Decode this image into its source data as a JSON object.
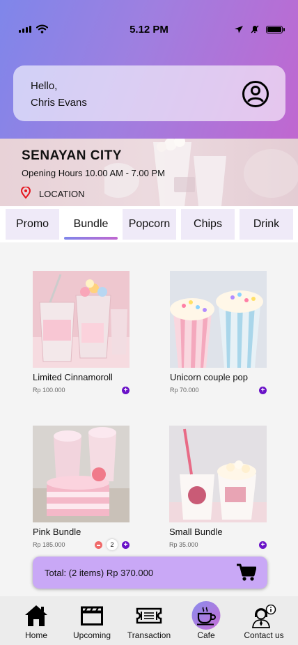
{
  "status_bar": {
    "time": "5.12 PM"
  },
  "greeting": {
    "hello": "Hello,",
    "name": "Chris Evans"
  },
  "location": {
    "name": "SENAYAN CITY",
    "hours": "Opening Hours 10.00 AM - 7.00 PM",
    "link_label": "LOCATION"
  },
  "tabs": [
    {
      "label": "Promo"
    },
    {
      "label": "Bundle"
    },
    {
      "label": "Popcorn"
    },
    {
      "label": "Chips"
    },
    {
      "label": "Drink"
    }
  ],
  "active_tab": "Bundle",
  "products": [
    {
      "name": "Limited Cinnamoroll",
      "price": "Rp 100.000"
    },
    {
      "name": "Unicorn couple pop",
      "price": "Rp 70.000"
    },
    {
      "name": "Pink Bundle",
      "price": "Rp 185.000",
      "quantity": "2"
    },
    {
      "name": "Small Bundle",
      "price": "Rp 35.000"
    }
  ],
  "cart": {
    "total_text": "Total: (2 items) Rp 370.000"
  },
  "nav": [
    {
      "label": "Home",
      "icon": "home-icon"
    },
    {
      "label": "Upcoming",
      "icon": "clapperboard-icon"
    },
    {
      "label": "Transaction",
      "icon": "ticket-icon"
    },
    {
      "label": "Cafe",
      "icon": "coffee-cup-icon"
    },
    {
      "label": "Contact us",
      "icon": "support-agent-icon"
    }
  ],
  "active_nav": "Cafe",
  "colors": {
    "accent": "#6a12c8",
    "cart_bar": "#c9a8f6",
    "tab_inactive": "#efeaf8",
    "minus": "#f06a6a"
  }
}
